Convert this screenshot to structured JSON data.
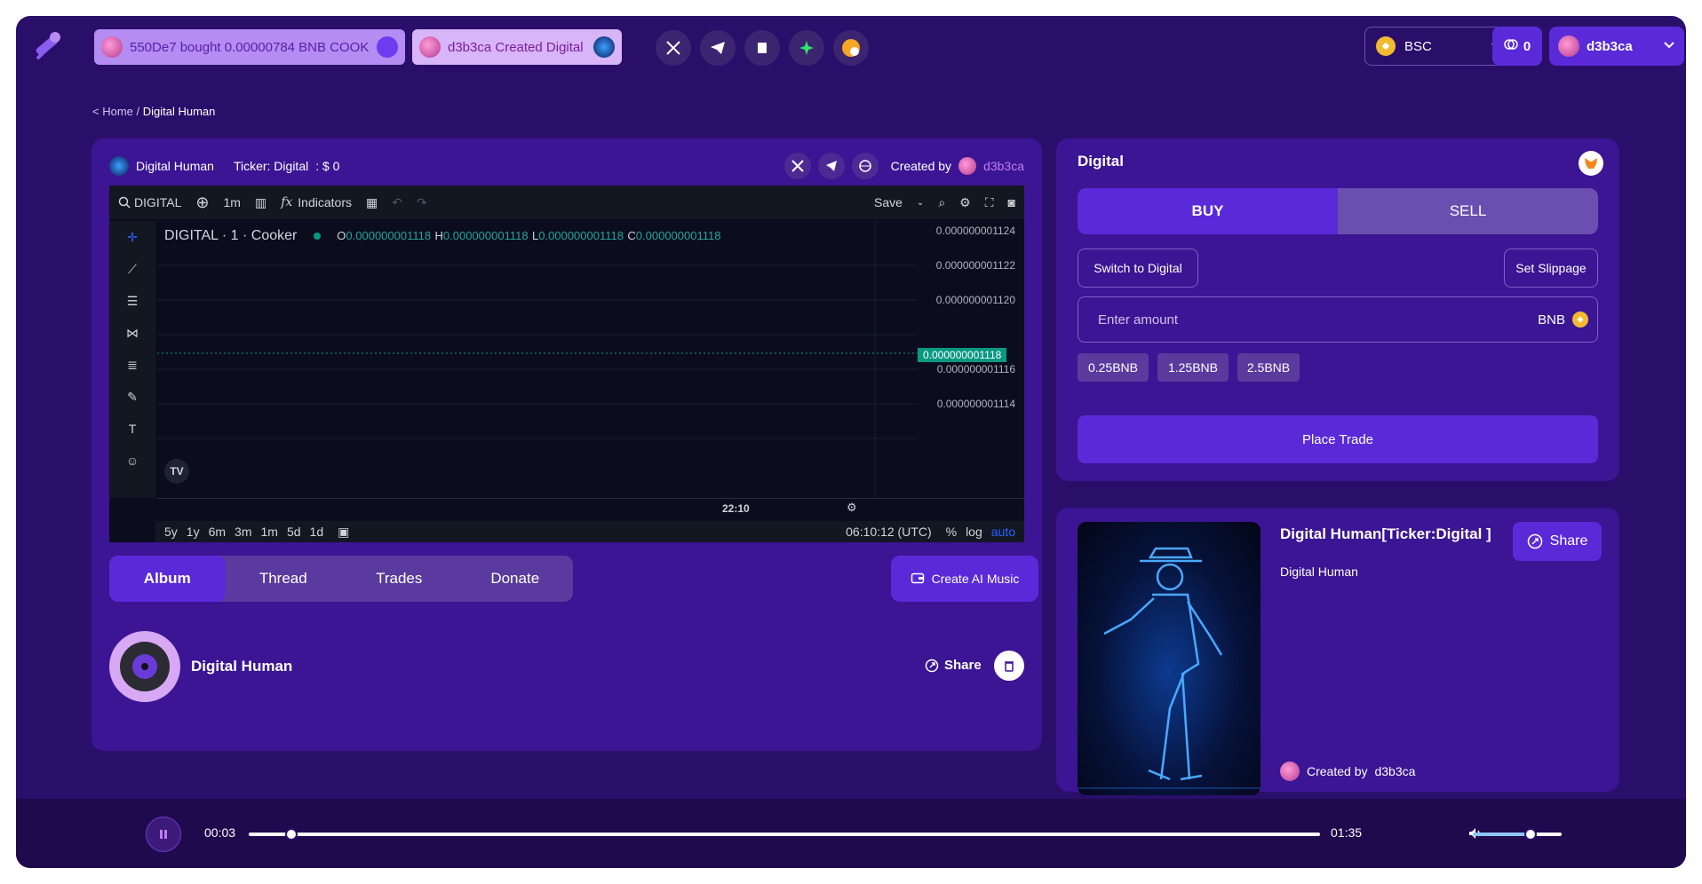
{
  "topbar": {
    "tickers": [
      {
        "text": "550De7 bought 0.00000784 BNB COOK"
      },
      {
        "text": "d3b3ca Created Digital"
      }
    ],
    "socials": [
      "x-icon",
      "telegram-icon",
      "docs-icon",
      "gear-star-icon",
      "dex-icon"
    ],
    "network": "BSC",
    "credits": "0",
    "user": "d3b3ca"
  },
  "breadcrumb": {
    "home": "< Home",
    "sep": " / ",
    "current": "Digital Human"
  },
  "chart_header": {
    "name": "Digital Human",
    "ticker": "Ticker: Digital",
    "price": ": $ 0",
    "created_by": "Created by",
    "creator": "d3b3ca"
  },
  "tv": {
    "symbol_search": "DIGITAL",
    "interval": "1m",
    "indicators": "Indicators",
    "save": "Save",
    "legend": "DIGITAL · 1 · Cooker",
    "o_label": "O",
    "o": "0.000000001118",
    "h_label": "H",
    "h": "0.000000001118",
    "l_label": "L",
    "l": "0.000000001118",
    "c_label": "C",
    "c": "0.000000001118",
    "price_axis": [
      "0.000000001124",
      "0.000000001122",
      "0.000000001120",
      "0.000000001116",
      "0.000000001114"
    ],
    "last_price": "0.000000001118",
    "time_label": "22:10",
    "ranges": [
      "5y",
      "1y",
      "6m",
      "3m",
      "1m",
      "5d",
      "1d"
    ],
    "clock": "06:10:12 (UTC)",
    "pct": "%",
    "log": "log",
    "auto": "auto"
  },
  "tabs": [
    "Album",
    "Thread",
    "Trades",
    "Donate"
  ],
  "create_ai": "Create AI Music",
  "track": {
    "title": "Digital Human",
    "share": "Share"
  },
  "trade": {
    "title": "Digital",
    "buy": "BUY",
    "sell": "SELL",
    "switch": "Switch to Digital",
    "slippage": "Set Slippage",
    "amount_placeholder": "Enter amount",
    "unit": "BNB",
    "quick": [
      "0.25BNB",
      "1.25BNB",
      "2.5BNB"
    ],
    "place": "Place Trade"
  },
  "token": {
    "name": "Digital Human[Ticker:Digital ]",
    "desc": "Digital Human",
    "share": "Share",
    "created_by": "Created by",
    "creator": "d3b3ca"
  },
  "player": {
    "elapsed": "00:03",
    "duration": "01:35",
    "progress": 0.04,
    "volume": 0.65
  },
  "colors": {
    "bg": "#2a0f6a",
    "panel": "#3b1593",
    "accent": "#5a2ad8",
    "up": "#26a69a"
  }
}
